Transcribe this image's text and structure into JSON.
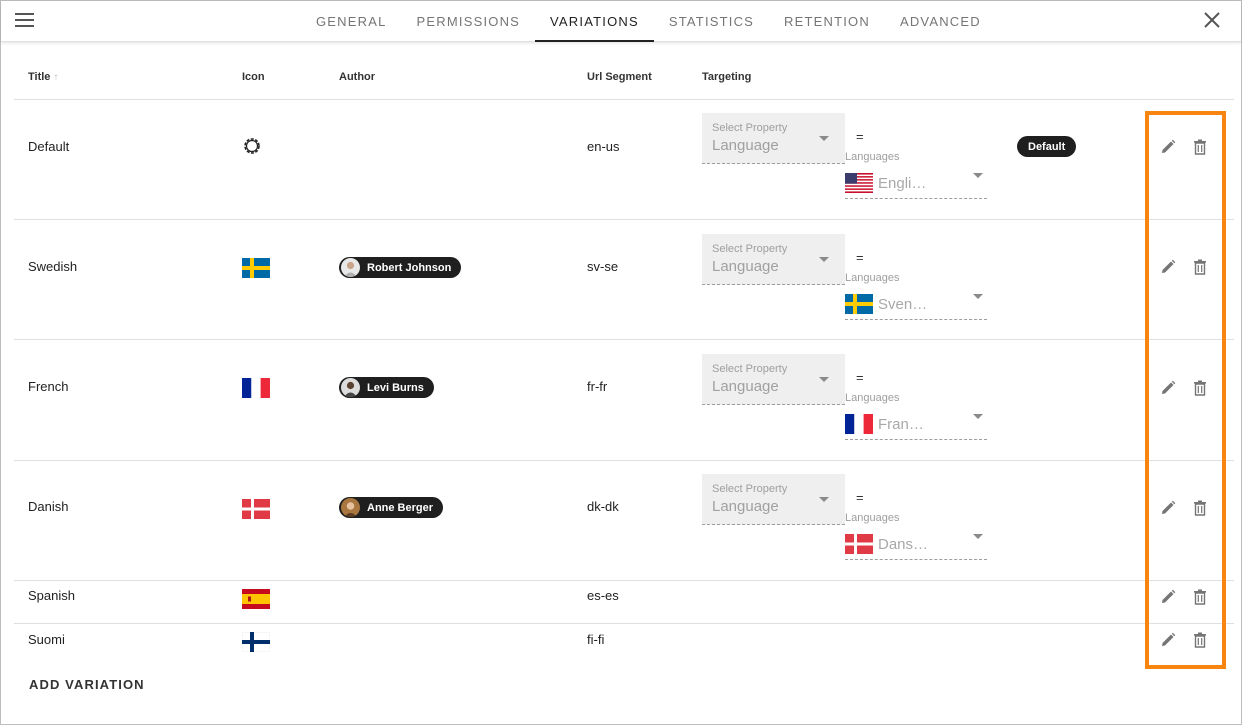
{
  "tabs": [
    {
      "label": "GENERAL",
      "active": false
    },
    {
      "label": "PERMISSIONS",
      "active": false
    },
    {
      "label": "VARIATIONS",
      "active": true
    },
    {
      "label": "STATISTICS",
      "active": false
    },
    {
      "label": "RETENTION",
      "active": false
    },
    {
      "label": "ADVANCED",
      "active": false
    }
  ],
  "columns": {
    "title": "Title",
    "icon": "Icon",
    "author": "Author",
    "url_segment": "Url Segment",
    "targeting": "Targeting"
  },
  "targeting_labels": {
    "select_property": "Select Property",
    "property_value": "Language",
    "operator": "=",
    "languages": "Languages"
  },
  "rows": [
    {
      "title": "Default",
      "icon": "gear-icon",
      "author": "",
      "url": "en-us",
      "lang": "Engli…",
      "lang_flag": "us",
      "badge": "Default"
    },
    {
      "title": "Swedish",
      "icon": "flag-se",
      "author": "Robert Johnson",
      "url": "sv-se",
      "lang": "Sven…",
      "lang_flag": "se"
    },
    {
      "title": "French",
      "icon": "flag-fr",
      "author": "Levi Burns",
      "url": "fr-fr",
      "lang": "Fran…",
      "lang_flag": "fr"
    },
    {
      "title": "Danish",
      "icon": "flag-dk",
      "author": "Anne Berger",
      "url": "dk-dk",
      "lang": "Dans…",
      "lang_flag": "dk"
    },
    {
      "title": "Spanish",
      "icon": "flag-es",
      "author": "",
      "url": "es-es"
    },
    {
      "title": "Suomi",
      "icon": "flag-fi",
      "author": "",
      "url": "fi-fi"
    }
  ],
  "add_variation": "ADD VARIATION",
  "colors": {
    "highlight": "#f7850f",
    "chip": "#1f1f1f",
    "active_tab": "#222222"
  }
}
